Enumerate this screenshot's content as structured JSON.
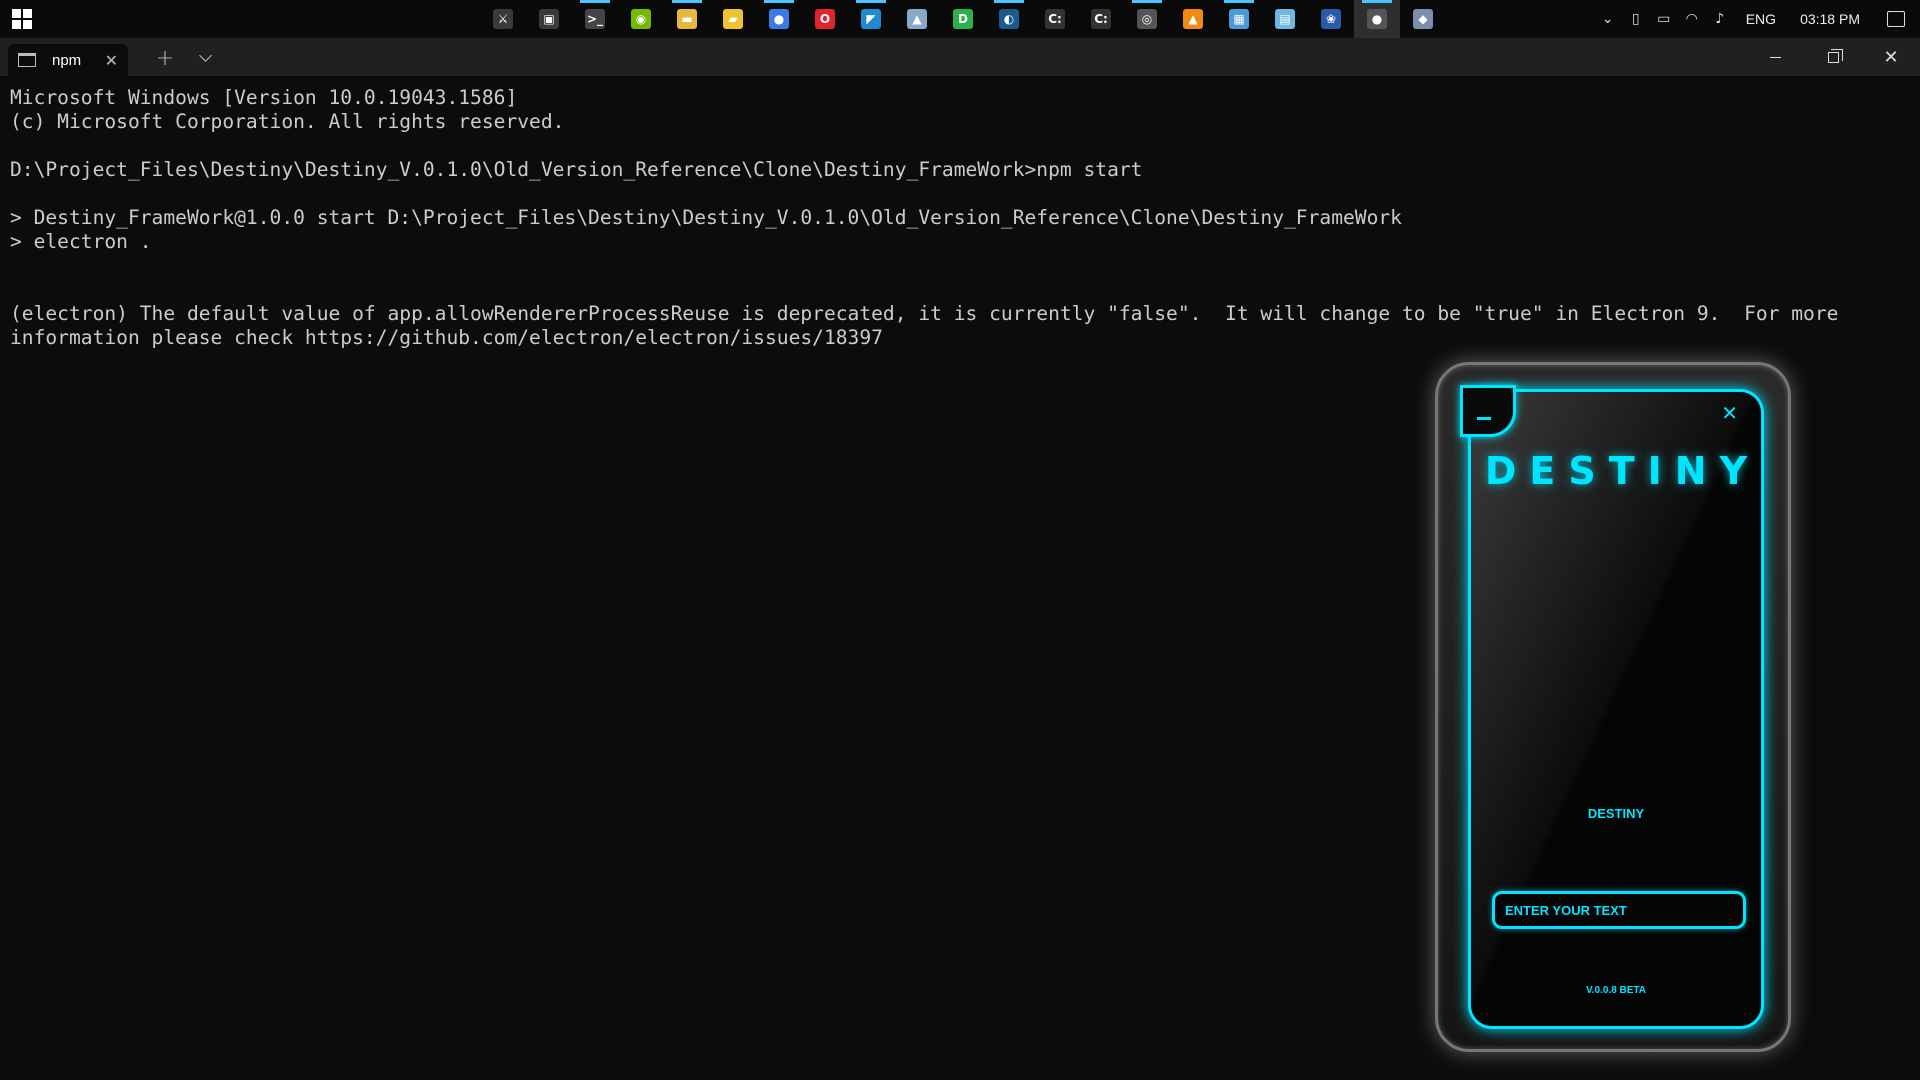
{
  "taskbar": {
    "start_icon": "windows-logo-icon",
    "apps": [
      {
        "icon": "razer-icon",
        "glyph": "⚔",
        "color": "#3a3a3a"
      },
      {
        "icon": "task-view-icon",
        "glyph": "▣",
        "color": "#3a3a3a"
      },
      {
        "icon": "terminal-icon",
        "glyph": ">_",
        "color": "#444444",
        "running": true
      },
      {
        "icon": "nvidia-icon",
        "glyph": "◉",
        "color": "#76b900"
      },
      {
        "icon": "file-explorer-icon",
        "glyph": "▬",
        "color": "#e8b83a",
        "running": true
      },
      {
        "icon": "folder-icon",
        "glyph": "▰",
        "color": "#f1c232"
      },
      {
        "icon": "firefox-icon",
        "glyph": "●",
        "color": "#3b7be8",
        "running": true
      },
      {
        "icon": "opera-icon",
        "glyph": "O",
        "color": "#e0242f"
      },
      {
        "icon": "vscode-icon",
        "glyph": "◤",
        "color": "#1f8ad2",
        "running": true
      },
      {
        "icon": "image-viewer-icon",
        "glyph": "▲",
        "color": "#8aa8c8"
      },
      {
        "icon": "hello-app-icon",
        "glyph": "D",
        "color": "#2bb24c"
      },
      {
        "icon": "steam-icon",
        "glyph": "◐",
        "color": "#1b5a8a",
        "running": true
      },
      {
        "icon": "cmd-icon",
        "glyph": "C:",
        "color": "#333333"
      },
      {
        "icon": "cmd-icon-2",
        "glyph": "C:",
        "color": "#333333"
      },
      {
        "icon": "obs-icon",
        "glyph": "◎",
        "color": "#555555",
        "running": true
      },
      {
        "icon": "vlc-icon",
        "glyph": "▲",
        "color": "#f28a10"
      },
      {
        "icon": "paint-icon",
        "glyph": "▦",
        "color": "#4a9bd6",
        "running": true
      },
      {
        "icon": "notepad-icon",
        "glyph": "▤",
        "color": "#6fb7e0"
      },
      {
        "icon": "ccleaner-icon",
        "glyph": "❀",
        "color": "#2a5aa8"
      },
      {
        "icon": "electron-icon",
        "glyph": "●",
        "color": "#555555",
        "running": true,
        "active": true
      },
      {
        "icon": "genshin-icon",
        "glyph": "◆",
        "color": "#7a8fb0"
      }
    ],
    "tray": {
      "language": "ENG",
      "time": "03:18 PM"
    }
  },
  "terminal": {
    "tab_title": "npm",
    "lines": [
      "Microsoft Windows [Version 10.0.19043.1586]",
      "(c) Microsoft Corporation. All rights reserved.",
      "",
      "D:\\Project_Files\\Destiny\\Destiny_V.0.1.0\\Old_Version_Reference\\Clone\\Destiny_FrameWork>npm start",
      "",
      "> Destiny_FrameWork@1.0.0 start D:\\Project_Files\\Destiny\\Destiny_V.0.1.0\\Old_Version_Reference\\Clone\\Destiny_FrameWork",
      "> electron .",
      "",
      "",
      "(electron) The default value of app.allowRendererProcessReuse is deprecated, it is currently \"false\".  It will change to be \"true\" in Electron 9.  For more",
      "information please check https://github.com/electron/electron/issues/18397"
    ]
  },
  "destiny": {
    "title": "DESTINY",
    "label": "DESTINY",
    "input_placeholder": "ENTER YOUR TEXT",
    "version": "V.0.0.8 BETA",
    "accent_color": "#00e5ff"
  }
}
